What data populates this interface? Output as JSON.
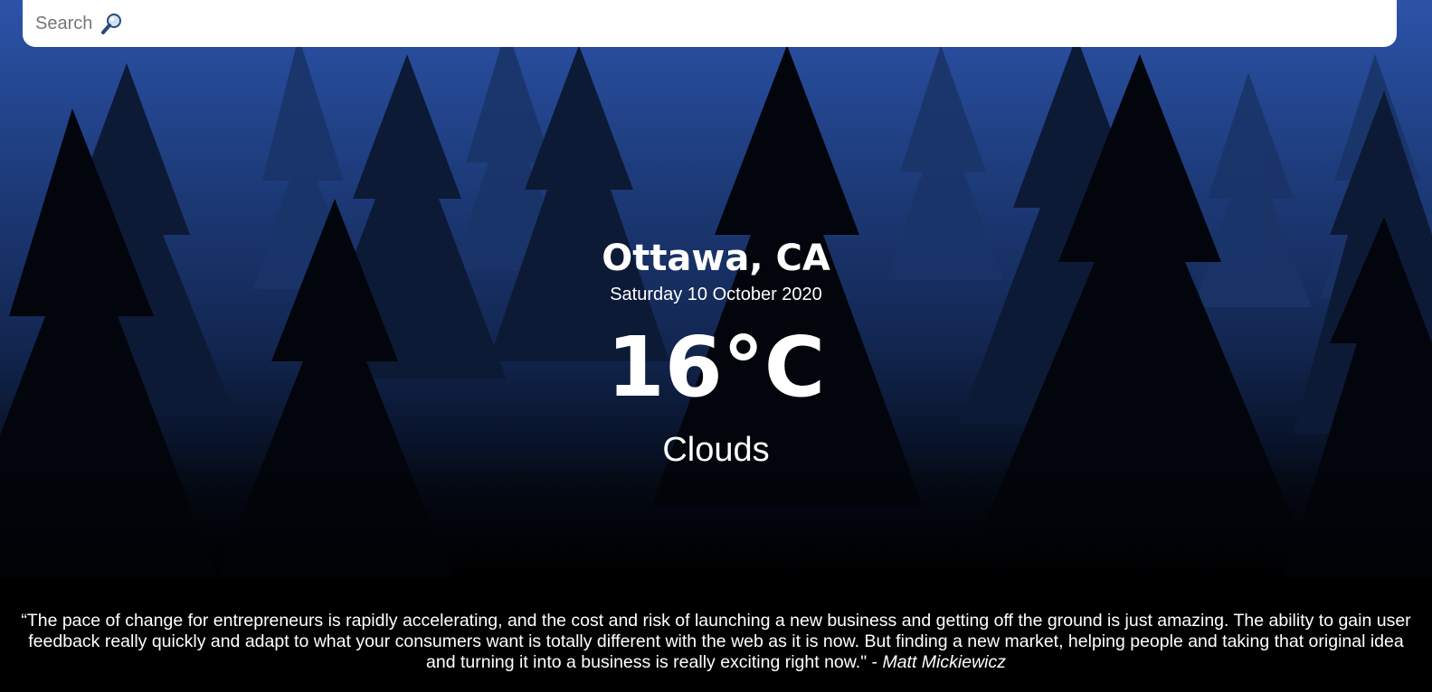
{
  "search": {
    "placeholder": "Search",
    "icon": "magnifying-glass-icon"
  },
  "weather": {
    "location": "Ottawa, CA",
    "date": "Saturday 10 October 2020",
    "temperature": "16°C",
    "condition": "Clouds"
  },
  "quote": {
    "text": "“The pace of change for entrepreneurs is rapidly accelerating, and the cost and risk of launching a new business and getting off the ground is just amazing. The ability to gain user feedback really quickly and adapt to what your consumers want is totally different with the web as it is now. But finding a new market, helping people and taking that original idea and turning it into a business is really exciting right now.\"",
    "separator": " - ",
    "author": "Matt Mickiewicz"
  },
  "colors": {
    "text": "#ffffff",
    "sky": "#2a4f9e",
    "search_background": "#ffffff"
  }
}
